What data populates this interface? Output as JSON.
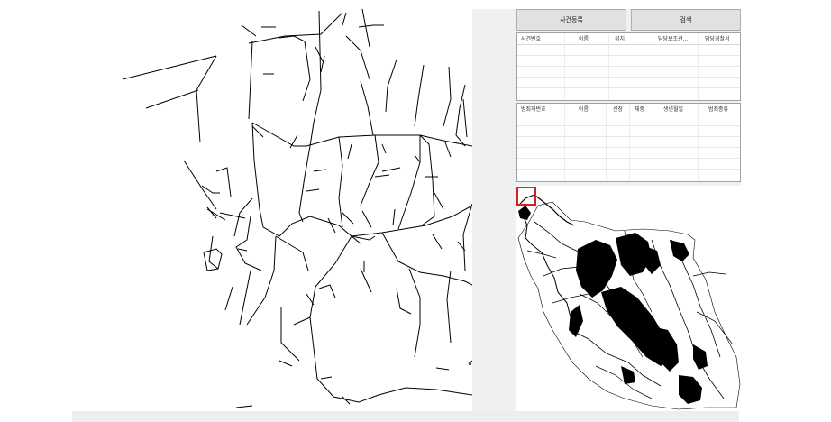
{
  "toolbar": {
    "register_label": "사건등록",
    "search_label": "검색"
  },
  "case_table": {
    "columns": [
      "사건번호",
      "이름",
      "위치",
      "담당보조관...",
      "담당경찰서"
    ],
    "rows": []
  },
  "criminal_table": {
    "columns": [
      "범죄자번호",
      "이름",
      "신장",
      "체중",
      "생년월일",
      "범죄종류"
    ],
    "rows": []
  },
  "colors": {
    "road": "#000000",
    "viewport": "#d42020",
    "panel": "#f0f0f0",
    "button": "#e1e1e1"
  }
}
